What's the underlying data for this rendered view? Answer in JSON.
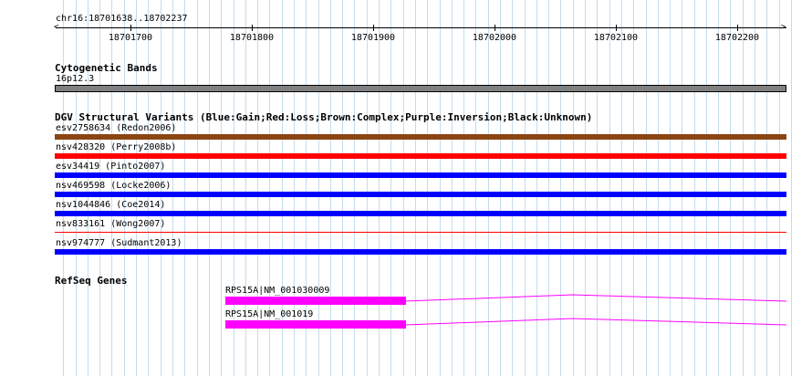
{
  "locus": "chr16:18701638..18702237",
  "ruler": {
    "ticks": [
      "18701700",
      "18701800",
      "18701900",
      "18702000",
      "18702100",
      "18702200"
    ],
    "left_arrow": "<",
    "right_arrow": ">"
  },
  "cytoband": {
    "title": "Cytogenetic Bands",
    "band": "16p12.3",
    "color": "#808080"
  },
  "dgv": {
    "title": "DGV Structural Variants (Blue:Gain;Red:Loss;Brown:Complex;Purple:Inversion;Black:Unknown)",
    "variants": [
      {
        "label": "esv2758634 (Redon2006)",
        "color": "#8b4513",
        "thick": true
      },
      {
        "label": "nsv428320 (Perry2008b)",
        "color": "#ff0000",
        "thick": true
      },
      {
        "label": "esv34419 (Pinto2007)",
        "color": "#0000ff",
        "thick": true
      },
      {
        "label": "nsv469598 (Locke2006)",
        "color": "#0000ff",
        "thick": true
      },
      {
        "label": "nsv1044846 (Coe2014)",
        "color": "#0000ff",
        "thick": true
      },
      {
        "label": "nsv833161 (Wong2007)",
        "color": "#ff0000",
        "thick": false
      },
      {
        "label": "nsv974777 (Sudmant2013)",
        "color": "#0000ff",
        "thick": true
      }
    ]
  },
  "refseq": {
    "title": "RefSeq Genes",
    "genes": [
      {
        "label": "RPS15A|NM_001030009",
        "color": "#ff00ff"
      },
      {
        "label": "RPS15A|NM_001019",
        "color": "#ff00ff"
      }
    ]
  }
}
